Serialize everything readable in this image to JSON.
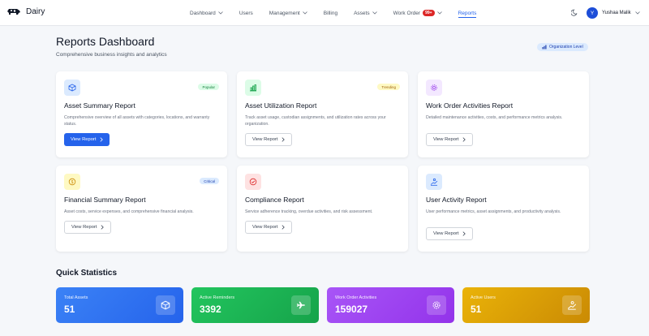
{
  "brand": {
    "name": "Dairy"
  },
  "nav": [
    {
      "label": "Dashboard",
      "dropdown": true,
      "active": false
    },
    {
      "label": "Users",
      "dropdown": false,
      "active": false
    },
    {
      "label": "Management",
      "dropdown": true,
      "active": false
    },
    {
      "label": "Billing",
      "dropdown": false,
      "active": false
    },
    {
      "label": "Assets",
      "dropdown": true,
      "active": false
    },
    {
      "label": "Work Order",
      "dropdown": true,
      "active": false,
      "badge": "99+"
    },
    {
      "label": "Reports",
      "dropdown": false,
      "active": true
    }
  ],
  "user": {
    "initial": "Y",
    "name": "Yushaa Malik"
  },
  "header": {
    "title": "Reports Dashboard",
    "subtitle": "Comprehensive business insights and analytics",
    "scope_label": "Organization Level"
  },
  "reports": [
    {
      "title": "Asset Summary Report",
      "tag": "Popular",
      "desc": "Comprehensive overview of all assets with categories, locations, and warranty status.",
      "button": "View Report",
      "icon": "cube-icon"
    },
    {
      "title": "Asset Utilization Report",
      "tag": "Trending",
      "desc": "Track asset usage, custodian assignments, and utilization rates across your organization.",
      "button": "View Report",
      "icon": "bar-chart-icon"
    },
    {
      "title": "Work Order Activities Report",
      "tag": "",
      "desc": "Detailed maintenance activities, costs, and performance metrics analysis.",
      "button": "View Report",
      "icon": "gear-icon"
    },
    {
      "title": "Financial Summary Report",
      "tag": "Critical",
      "desc": "Asset costs, service expenses, and comprehensive financial analysis.",
      "button": "View Report",
      "icon": "dollar-icon"
    },
    {
      "title": "Compliance Report",
      "tag": "",
      "desc": "Service adherence tracking, overdue activities, and risk assessment.",
      "button": "View Report",
      "icon": "check-circle-icon"
    },
    {
      "title": "User Activity Report",
      "tag": "",
      "desc": "User performance metrics, asset assignments, and productivity analysis.",
      "button": "View Report",
      "icon": "user-activity-icon"
    }
  ],
  "quick_stats": {
    "title": "Quick Statistics",
    "items": [
      {
        "label": "Total Assets",
        "value": "51",
        "icon": "cube-icon",
        "color_from": "#3b82f6",
        "color_to": "#2563eb"
      },
      {
        "label": "Active Reminders",
        "value": "3392",
        "icon": "plane-icon",
        "color_from": "#22c55e",
        "color_to": "#16a34a"
      },
      {
        "label": "Work Order Activities",
        "value": "159027",
        "icon": "gear-icon",
        "color_from": "#a855f7",
        "color_to": "#9333ea"
      },
      {
        "label": "Active Users",
        "value": "51",
        "icon": "user-activity-icon",
        "color_from": "#eab308",
        "color_to": "#ca8a04"
      }
    ]
  },
  "colors": {
    "accent": "#2563eb",
    "tag_popular_bg": "#dcfce7",
    "tag_popular_fg": "#15803d",
    "tag_trending_bg": "#fef9c3",
    "tag_trending_fg": "#a16207",
    "tag_critical_bg": "#dbeafe",
    "tag_critical_fg": "#1e40af"
  }
}
